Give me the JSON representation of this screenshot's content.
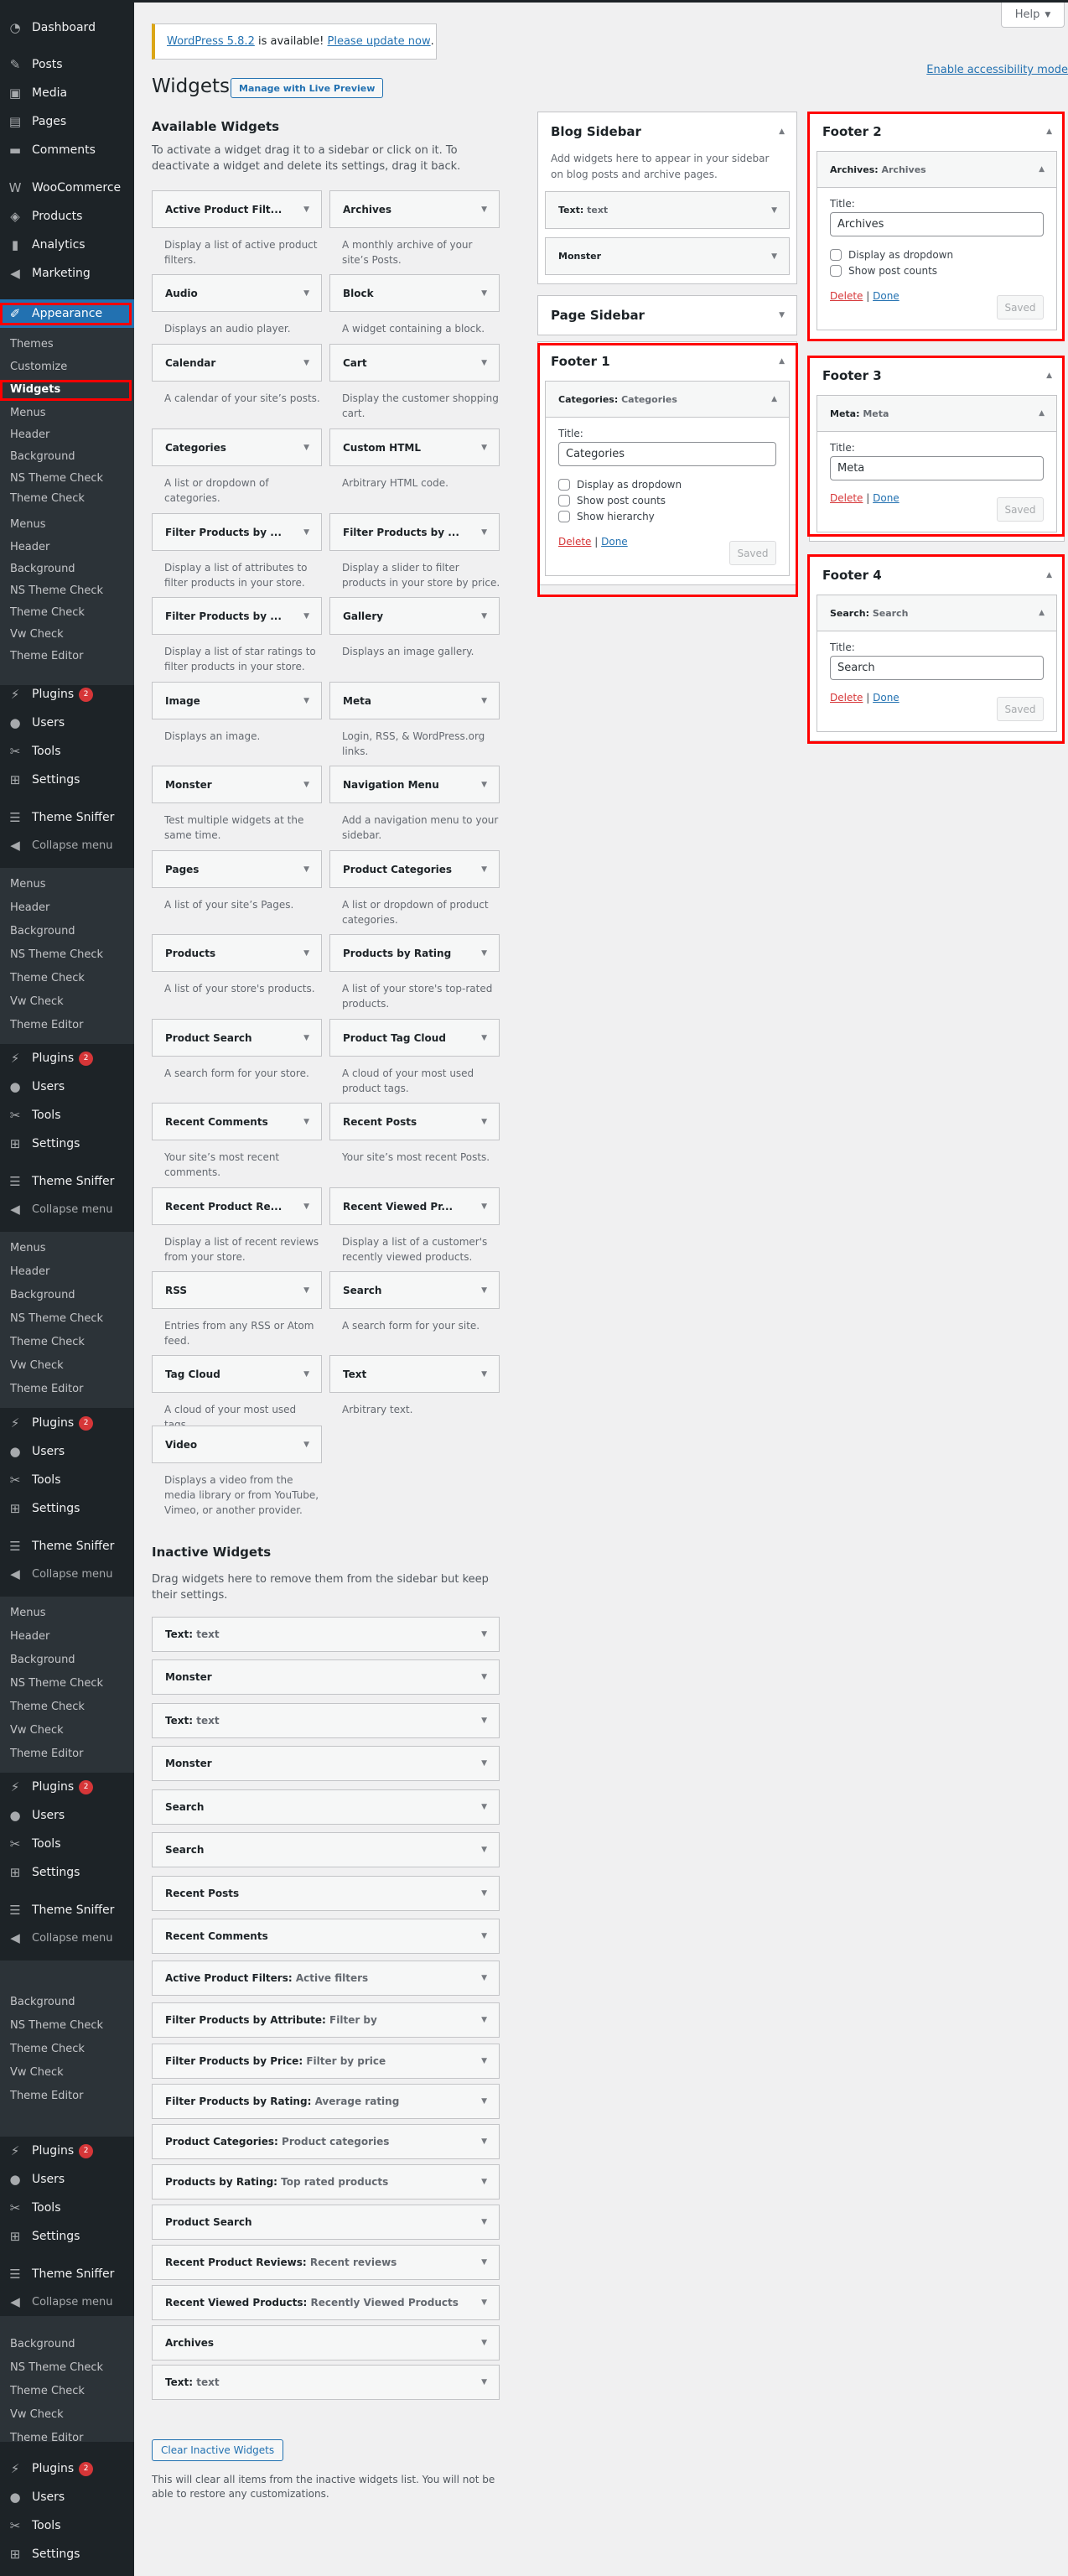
{
  "help": {
    "label": "Help"
  },
  "notice": {
    "version_link": "WordPress 5.8.2",
    "middle": " is available! ",
    "update_link": "Please update now",
    "end": "."
  },
  "header": {
    "title": "Widgets",
    "live_preview": "Manage with Live Preview",
    "accessibility_link": "Enable accessibility mode"
  },
  "sidebar": {
    "menu": {
      "dashboard": "Dashboard",
      "posts": "Posts",
      "media": "Media",
      "pages": "Pages",
      "comments": "Comments",
      "woocommerce": "WooCommerce",
      "products": "Products",
      "analytics": "Analytics",
      "marketing": "Marketing",
      "appearance": "Appearance",
      "plugins": "Plugins",
      "plugins_badge": "2",
      "users": "Users",
      "tools": "Tools",
      "settings": "Settings",
      "theme_sniffer": "Theme Sniffer",
      "collapse": "Collapse menu"
    },
    "submenu": {
      "themes": "Themes",
      "customize": "Customize",
      "widgets": "Widgets",
      "menus": "Menus",
      "header": "Header",
      "background": "Background",
      "ns_theme_check": "NS Theme Check",
      "theme_check": "Theme Check",
      "vw_check": "Vw Check",
      "theme_editor": "Theme Editor"
    }
  },
  "available": {
    "title": "Available Widgets",
    "description": "To activate a widget drag it to a sidebar or click on it. To deactivate a widget and delete its settings, drag it back.",
    "widgets": [
      {
        "name": "Active Product Filt...",
        "desc": "Display a list of active product filters."
      },
      {
        "name": "Archives",
        "desc": "A monthly archive of your site’s Posts."
      },
      {
        "name": "Audio",
        "desc": "Displays an audio player."
      },
      {
        "name": "Block",
        "desc": "A widget containing a block."
      },
      {
        "name": "Calendar",
        "desc": "A calendar of your site’s posts."
      },
      {
        "name": "Cart",
        "desc": "Display the customer shopping cart."
      },
      {
        "name": "Categories",
        "desc": "A list or dropdown of categories."
      },
      {
        "name": "Custom HTML",
        "desc": "Arbitrary HTML code."
      },
      {
        "name": "Filter Products by ...",
        "desc": "Display a list of attributes to filter products in your store."
      },
      {
        "name": "Filter Products by ...",
        "desc": "Display a slider to filter products in your store by price."
      },
      {
        "name": "Filter Products by ...",
        "desc": "Display a list of star ratings to filter products in your store."
      },
      {
        "name": "Gallery",
        "desc": "Displays an image gallery."
      },
      {
        "name": "Image",
        "desc": "Displays an image."
      },
      {
        "name": "Meta",
        "desc": "Login, RSS, & WordPress.org links."
      },
      {
        "name": "Monster",
        "desc": "Test multiple widgets at the same time."
      },
      {
        "name": "Navigation Menu",
        "desc": "Add a navigation menu to your sidebar."
      },
      {
        "name": "Pages",
        "desc": "A list of your site’s Pages."
      },
      {
        "name": "Product Categories",
        "desc": "A list or dropdown of product categories."
      },
      {
        "name": "Products",
        "desc": "A list of your store's products."
      },
      {
        "name": "Products by Rating",
        "desc": "A list of your store's top-rated products."
      },
      {
        "name": "Product Search",
        "desc": "A search form for your store."
      },
      {
        "name": "Product Tag Cloud",
        "desc": "A cloud of your most used product tags."
      },
      {
        "name": "Recent Comments",
        "desc": "Your site’s most recent comments."
      },
      {
        "name": "Recent Posts",
        "desc": "Your site’s most recent Posts."
      },
      {
        "name": "Recent Product Re...",
        "desc": "Display a list of recent reviews from your store."
      },
      {
        "name": "Recent Viewed Pr...",
        "desc": "Display a list of a customer's recently viewed products."
      },
      {
        "name": "RSS",
        "desc": "Entries from any RSS or Atom feed."
      },
      {
        "name": "Search",
        "desc": "A search form for your site."
      },
      {
        "name": "Tag Cloud",
        "desc": "A cloud of your most used tags."
      },
      {
        "name": "Text",
        "desc": "Arbitrary text."
      },
      {
        "name": "Video",
        "desc": "Displays a video from the media library or from YouTube, Vimeo, or another provider."
      }
    ]
  },
  "inactive": {
    "title": "Inactive Widgets",
    "description": "Drag widgets here to remove them from the sidebar but keep their settings.",
    "widgets": [
      {
        "name": "Text",
        "sub": "text"
      },
      {
        "name": "Monster",
        "sub": ""
      },
      {
        "name": "Text",
        "sub": "text"
      },
      {
        "name": "Monster",
        "sub": ""
      },
      {
        "name": "Search",
        "sub": ""
      },
      {
        "name": "Search",
        "sub": ""
      },
      {
        "name": "Recent Posts",
        "sub": ""
      },
      {
        "name": "Recent Comments",
        "sub": ""
      },
      {
        "name": "Active Product Filters",
        "sub": "Active filters"
      },
      {
        "name": "Filter Products by Attribute",
        "sub": "Filter by"
      },
      {
        "name": "Filter Products by Price",
        "sub": "Filter by price"
      },
      {
        "name": "Filter Products by Rating",
        "sub": "Average rating"
      },
      {
        "name": "Product Categories",
        "sub": "Product categories"
      },
      {
        "name": "Products by Rating",
        "sub": "Top rated products"
      },
      {
        "name": "Product Search",
        "sub": ""
      },
      {
        "name": "Recent Product Reviews",
        "sub": "Recent reviews"
      },
      {
        "name": "Recent Viewed Products",
        "sub": "Recently Viewed Products"
      },
      {
        "name": "Archives",
        "sub": ""
      },
      {
        "name": "Text",
        "sub": "text"
      }
    ],
    "clear_button": "Clear Inactive Widgets",
    "clear_description": "This will clear all items from the inactive widgets list. You will not be able to restore any customizations."
  },
  "areas": {
    "blog_sidebar": {
      "title": "Blog Sidebar",
      "description": "Add widgets here to appear in your sidebar on blog posts and archive pages.",
      "widgets": [
        {
          "name": "Text",
          "sub": "text"
        },
        {
          "name": "Monster",
          "sub": ""
        }
      ]
    },
    "page_sidebar": {
      "title": "Page Sidebar"
    },
    "footer1": {
      "title": "Footer 1",
      "widget": {
        "name": "Categories",
        "sub": "Categories",
        "title_label": "Title:",
        "title_value": "Categories",
        "options": [
          "Display as dropdown",
          "Show post counts",
          "Show hierarchy"
        ]
      }
    },
    "footer2": {
      "title": "Footer 2",
      "widget": {
        "name": "Archives",
        "sub": "Archives",
        "title_label": "Title:",
        "title_value": "Archives",
        "options": [
          "Display as dropdown",
          "Show post counts"
        ]
      }
    },
    "footer3": {
      "title": "Footer 3",
      "widget": {
        "name": "Meta",
        "sub": "Meta",
        "title_label": "Title:",
        "title_value": "Meta"
      }
    },
    "footer4": {
      "title": "Footer 4",
      "widget": {
        "name": "Search",
        "sub": "Search",
        "title_label": "Title:",
        "title_value": "Search"
      }
    },
    "actions": {
      "delete": "Delete",
      "separator": " | ",
      "done": "Done",
      "saved": "Saved"
    }
  },
  "colors": {
    "admin_bar": "#1d2327",
    "accent": "#2271b1",
    "highlight": "#ff0000",
    "notice_warning": "#dba617",
    "badge": "#d63638"
  }
}
